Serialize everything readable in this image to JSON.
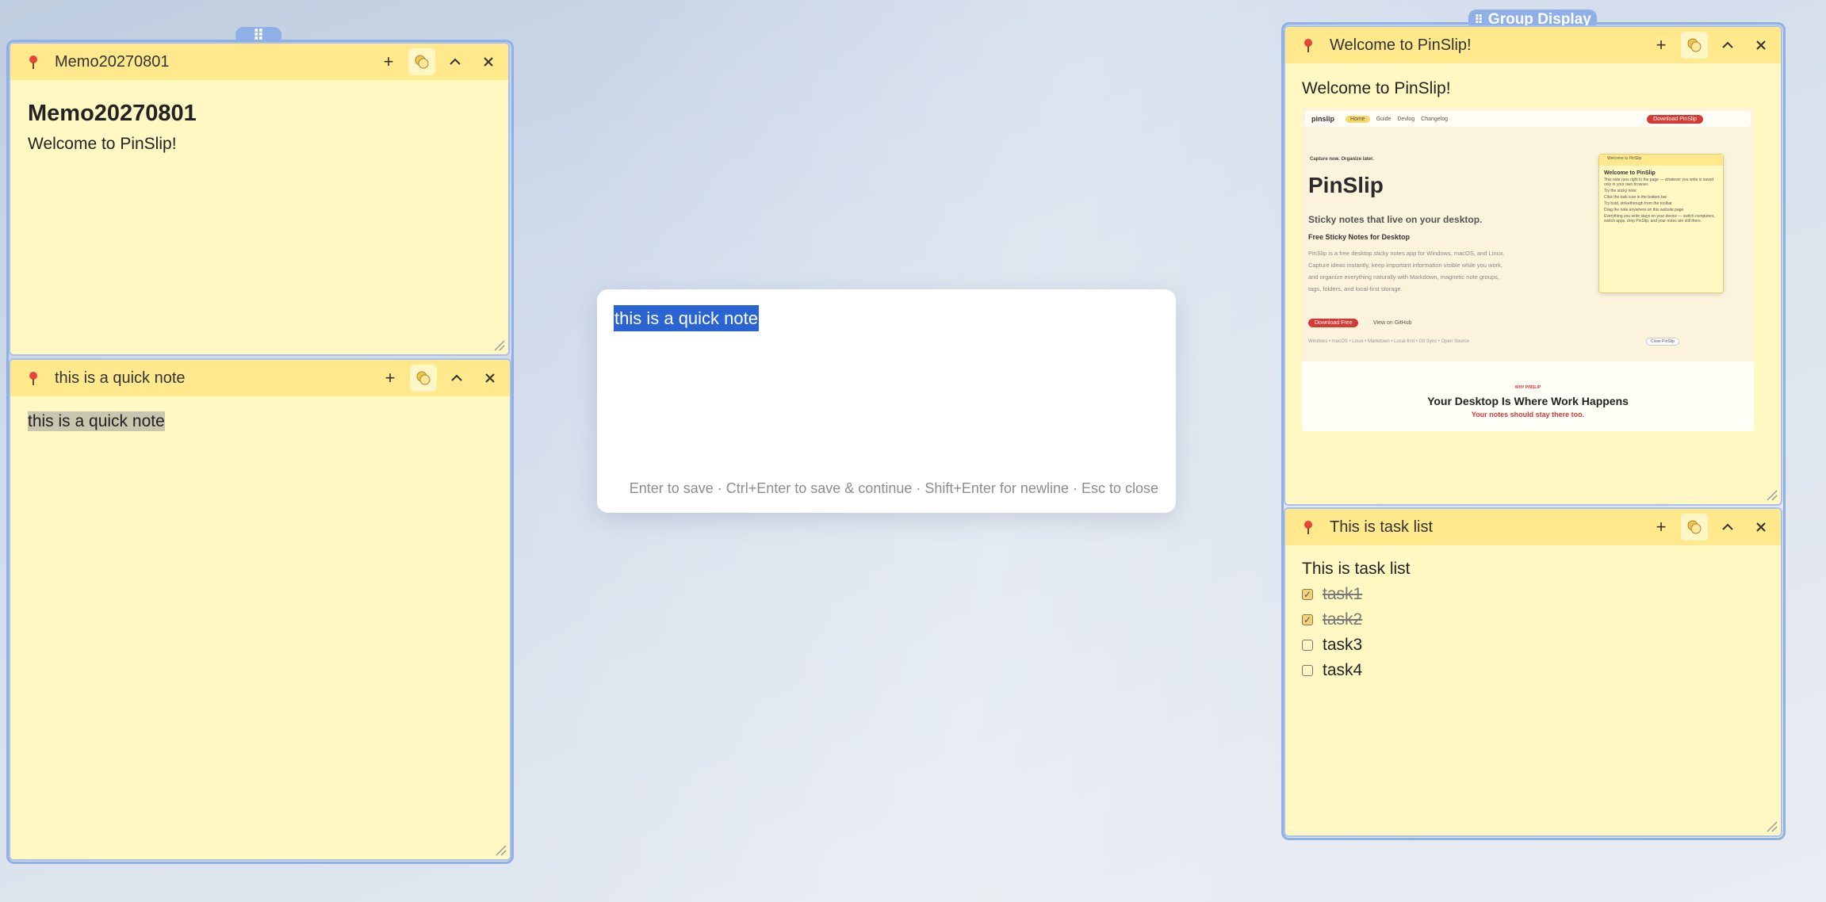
{
  "group_left": {
    "handle": "⠿"
  },
  "group_right": {
    "label": "Group Display",
    "handle": "⠿"
  },
  "memo_note": {
    "title": "Memo20270801",
    "heading": "Memo20270801",
    "text": "Welcome to PinSlip!"
  },
  "quick_note_card": {
    "title": "this is a quick note",
    "text": "this is a quick note"
  },
  "quick_popup": {
    "input_value": "this is a quick note",
    "hint": "Enter to save · Ctrl+Enter to save & continue · Shift+Enter for newline · Esc to close"
  },
  "welcome_note": {
    "title": "Welcome to PinSlip!",
    "text": "Welcome to PinSlip!",
    "screenshot": {
      "logo": "pinslip",
      "nav": [
        "Home",
        "Guide",
        "Devlog",
        "Changelog"
      ],
      "download_btn": "Download PinSlip",
      "tagline_small": "Capture now. Organize later.",
      "brand": "PinSlip",
      "headline": "Sticky notes that live on your desktop.",
      "subhead": "Free Sticky Notes for Desktop",
      "desc": "PinSlip is a free desktop sticky notes app for Windows, macOS, and Linux. Capture ideas instantly, keep important information visible while you work, and organize everything naturally with Markdown, magnetic note groups, tags, folders, and local-first storage.",
      "cta": "Download Free",
      "github": "View on GitHub",
      "platforms": "Windows • macOS • Linux • Markdown • Local-first • Git Sync • Open Source",
      "mini_title": "Welcome to PinSlip",
      "mini_lines": [
        "This note runs right in the page — whatever you write is saved only in your own browser.",
        "Try the sticky note:",
        "Click the task icon in the bottom bar",
        "Try bold, strikethrough from the toolbar",
        "Drag the note anywhere on this website page",
        "Everything you write stays on your device — switch computers, switch apps, drop PinSlip, and your notes are still there."
      ],
      "close_btn": "Close PinSlip",
      "why": "WHY PINSLIP",
      "why_title": "Your Desktop Is Where Work Happens",
      "why_sub": "Your notes should stay there too."
    }
  },
  "task_note": {
    "title": "This is task list",
    "text": "This is task list",
    "tasks": [
      {
        "label": "task1",
        "done": true
      },
      {
        "label": "task2",
        "done": true
      },
      {
        "label": "task3",
        "done": false
      },
      {
        "label": "task4",
        "done": false
      }
    ]
  },
  "colors": {
    "accent": "#2a64d2",
    "note_bg": "#fff8c2",
    "note_header": "#ffe98c",
    "group_border": "#8fb0e6",
    "pin": "#e8433a"
  }
}
